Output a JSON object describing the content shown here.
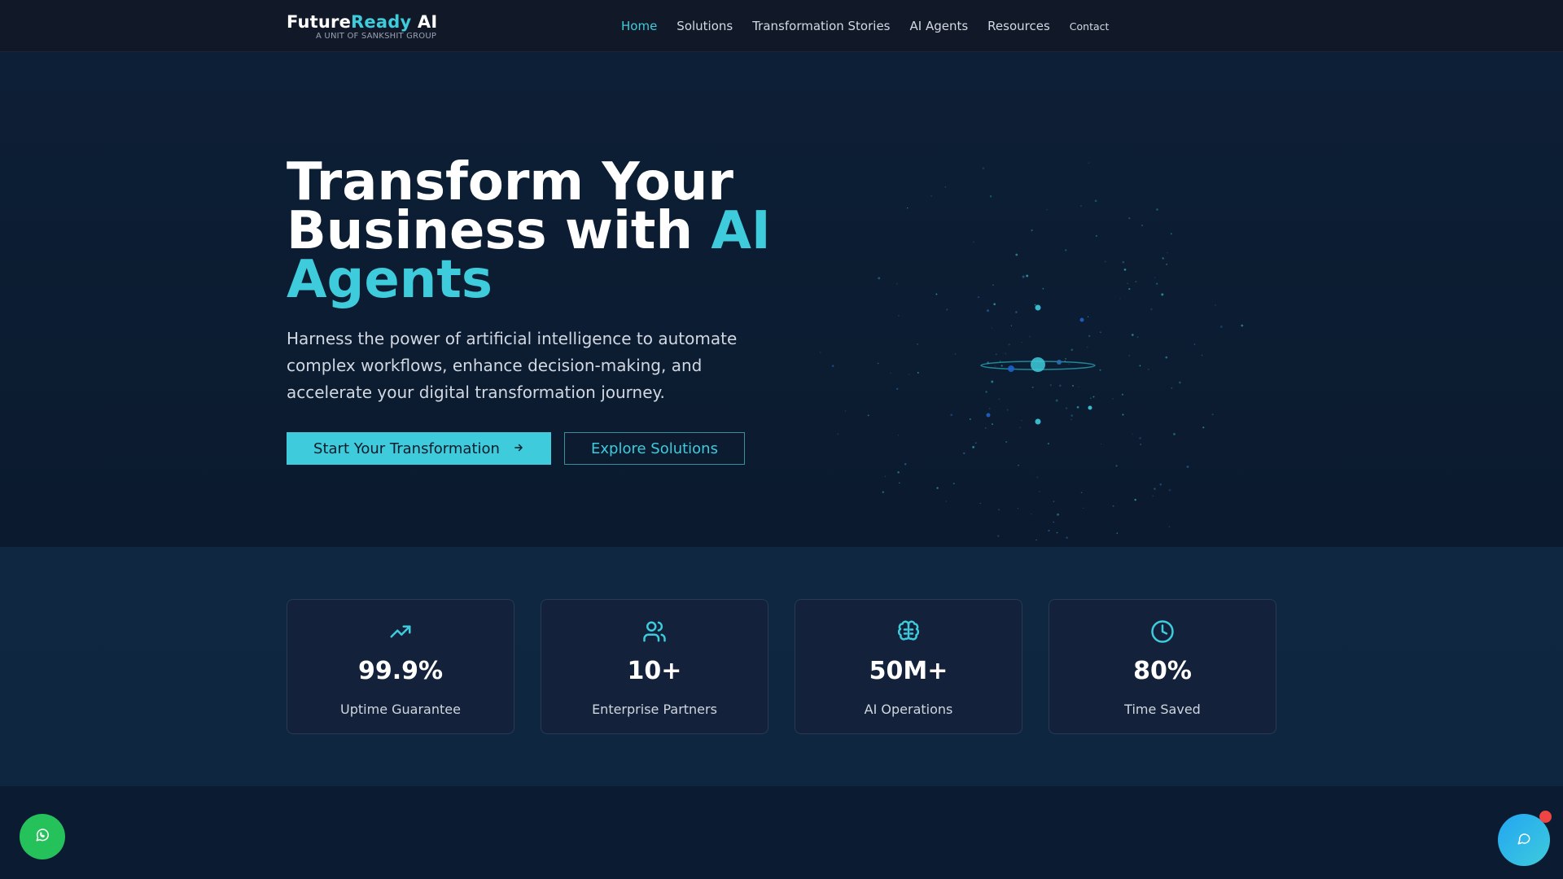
{
  "brand": {
    "name_part1": "Future",
    "name_part2": "Ready",
    "name_part3": " AI",
    "tagline": "A UNIT OF SANKSHIT GROUP",
    "accent_color": "#3ecbdc"
  },
  "nav": {
    "items": [
      {
        "label": "Home",
        "active": true
      },
      {
        "label": "Solutions"
      },
      {
        "label": "Transformation Stories"
      },
      {
        "label": "AI Agents"
      },
      {
        "label": "Resources"
      },
      {
        "label": "Contact"
      }
    ]
  },
  "hero": {
    "title_line1": "Transform Your",
    "title_line2": "Business with ",
    "title_accent": "AI Agents",
    "description": "Harness the power of artificial intelligence to automate complex workflows, enhance decision-making, and accelerate your digital transformation journey.",
    "primary_button": "Start Your Transformation",
    "secondary_button": "Explore Solutions"
  },
  "stats": [
    {
      "icon": "trending-up-icon",
      "value": "99.9%",
      "label": "Uptime Guarantee"
    },
    {
      "icon": "users-icon",
      "value": "10+",
      "label": "Enterprise Partners"
    },
    {
      "icon": "brain-icon",
      "value": "50M+",
      "label": "AI Operations"
    },
    {
      "icon": "clock-icon",
      "value": "80%",
      "label": "Time Saved"
    }
  ],
  "floating": {
    "whatsapp_icon": "whatsapp-icon",
    "chat_icon": "chat-bubble-icon"
  }
}
